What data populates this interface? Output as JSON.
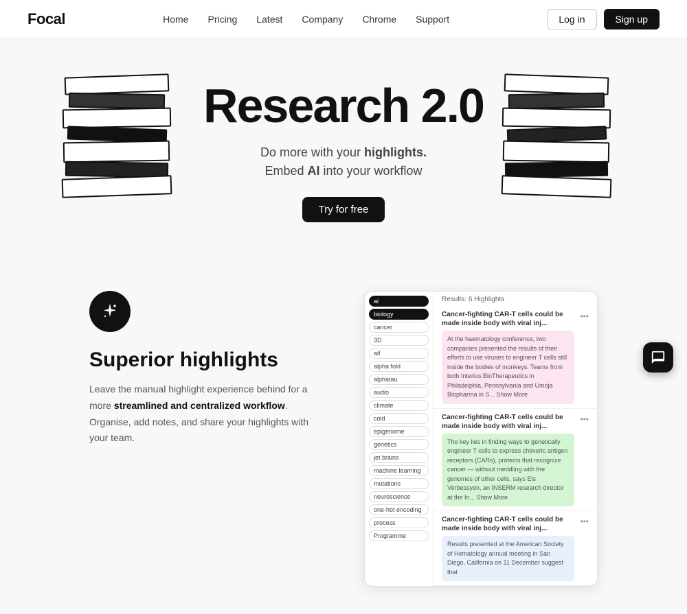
{
  "nav": {
    "logo": "Focal",
    "links": [
      "Home",
      "Pricing",
      "Latest",
      "Company",
      "Chrome",
      "Support"
    ],
    "login_label": "Log in",
    "signup_label": "Sign up"
  },
  "hero": {
    "title": "Research 2.0",
    "subtitle_plain": "Do more with your ",
    "subtitle_bold": "highlights.",
    "subtitle_line2_plain": "Embed ",
    "subtitle_line2_em": "AI",
    "subtitle_line2_rest": " into your workflow",
    "cta": "Try for free"
  },
  "section2": {
    "icon": "sparkle",
    "heading": "Superior highlights",
    "body_plain": "Leave the manual highlight experience behind for a more ",
    "body_bold": "streamlined and centralized workflow",
    "body_rest": ". Organise, add notes, and share your highlights with your team."
  },
  "mock": {
    "tags": [
      "ai",
      "biology"
    ],
    "filter_tag": "cancer",
    "results": "Results: 6 Highlights",
    "sidebar_chips": [
      "3D",
      "aif",
      "alpha fold",
      "alphatau",
      "audio",
      "climate",
      "cold",
      "epigenome",
      "genetics",
      "jet brains",
      "machine learning",
      "mutations",
      "neuroscience",
      "one-hot encoding",
      "process",
      "Programme"
    ],
    "items": [
      {
        "title": "Cancer-fighting CAR-T cells could be made inside body with viral inj...",
        "body": "At the haematology conference, two companies presented the results of their efforts to use viruses to engineer T cells still inside the bodies of monkeys. Teams from both Interius BioTherapeutics in Philadelphia, Pennsylvania and Umoja Biopharma in S... Show More",
        "color": "pink"
      },
      {
        "title": "Cancer-fighting CAR-T cells could be made inside body with viral inj...",
        "body": "The key lies in finding ways to genetically engineer T cells to express chimeric antigen receptors (CARs), proteins that recognize cancer — without meddling with the genomes of other cells, says Els Verbessyen, an INSERM research director at the In... Show More",
        "color": "green"
      },
      {
        "title": "Cancer-fighting CAR-T cells could be made inside body with viral inj...",
        "body": "Results presented at the American Society of Hematology annual meeting in San Diego, California on 11 December suggest that",
        "color": "blue"
      }
    ]
  },
  "chat": {
    "icon": "chat"
  }
}
